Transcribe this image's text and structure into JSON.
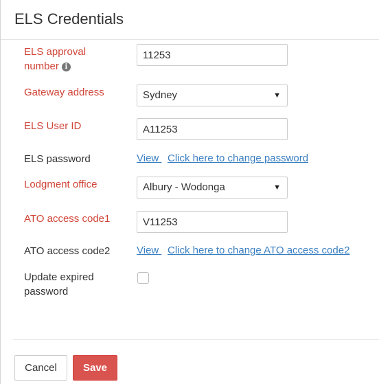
{
  "dialog": {
    "title": "ELS Credentials"
  },
  "fields": {
    "approval_number": {
      "label_line1": "ELS approval",
      "label_line2": "number",
      "icon": "info-icon",
      "value": "11253"
    },
    "gateway_address": {
      "label": "Gateway address",
      "selected": "Sydney"
    },
    "user_id": {
      "label": "ELS User ID",
      "value": "A11253"
    },
    "password": {
      "label": "ELS password",
      "view_link": "View ",
      "change_link": "Click here to change password"
    },
    "lodgment_office": {
      "label": "Lodgment office",
      "selected": "Albury - Wodonga"
    },
    "ato_access_code1": {
      "label": "ATO access code1",
      "value": "V11253"
    },
    "ato_access_code2": {
      "label": "ATO access code2",
      "view_link": "View ",
      "change_link": "Click here to change ATO access code2"
    },
    "update_expired": {
      "label_line1": "Update expired",
      "label_line2": "password",
      "checked": false
    }
  },
  "footer": {
    "cancel_label": "Cancel",
    "save_label": "Save"
  },
  "colors": {
    "required_label": "#d04437",
    "link": "#3a7fc1",
    "save_button": "#d9534f"
  }
}
